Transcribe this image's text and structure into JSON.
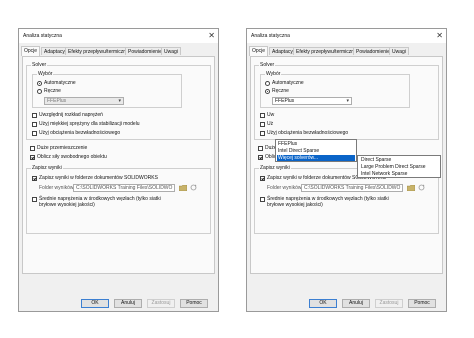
{
  "dialog": {
    "title": "Analiza statyczna",
    "close_glyph": "✕",
    "tabs": [
      "Opcje",
      "Adaptacyjne",
      "Efekty przepływu/termiczne",
      "Powiadomienie",
      "Uwagi"
    ],
    "solver_group": "Solver",
    "wybor_group": "Wybór",
    "radio_auto": "Automatyczne",
    "radio_manual": "Ręczne",
    "solver_value": "FFEPlus",
    "opt_large_disp": "Uwzględnij rozkład naprężeń",
    "opt_soft_springs": "Użyj miękkiej sprężyny dla stabilizacji modelu",
    "opt_inertial": "Użyj obciążenia bezwładnościowego",
    "opt_large_displacement": "Duże przemieszczenie",
    "opt_free_body": "Oblicz siły swobodnego obiektu",
    "save_group": "Zapisz wyniki",
    "save_in_folder": "Zapisz wyniki w folderze dokumentów SOLIDWORKS",
    "folder_label": "Folder wyników",
    "folder_path": "C:\\SOLIDWORKS Training Files\\SOLIDWO",
    "avg_stress": "Średnie naprężenia w środkowych węzłach (tylko siatki bryłowe wysokiej jakości)",
    "buttons": {
      "ok": "OK",
      "cancel": "Anuluj",
      "apply": "Zastosuj",
      "help": "Pomoc"
    }
  },
  "right_state": {
    "opt_large_disp_truncated": "Uw",
    "opt_soft_springs_truncated": "Uż",
    "opt_inertial_truncated": "Użyj obciążenia bezwładnościowego",
    "dropdown_items": [
      "FFEPlus",
      "Intel Direct Sparse",
      "Więcej solverów..."
    ],
    "highlighted_index": 2,
    "submenu_items": [
      "Direct Sparse",
      "Large Problem Direct Sparse",
      "Intel Network Sparse"
    ]
  },
  "icons": {
    "folder": "folder-icon",
    "refresh": "refresh-icon",
    "dropdown": "chevron-down-icon"
  }
}
